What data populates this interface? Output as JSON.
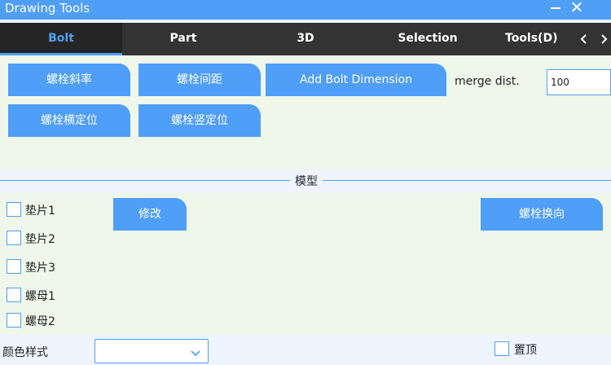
{
  "window": {
    "title": "Drawing Tools"
  },
  "tabs": [
    {
      "label": "Bolt",
      "active": true
    },
    {
      "label": "Part"
    },
    {
      "label": "3D"
    },
    {
      "label": "Selection"
    },
    {
      "label": "Tools(D)"
    }
  ],
  "bolt_panel": {
    "buttons": [
      "螺栓斜率",
      "螺栓间距",
      "Add Bolt Dimension",
      "螺栓横定位",
      "螺栓竖定位"
    ],
    "merge_label": "merge dist.",
    "merge_value": "100"
  },
  "model_section": {
    "title": "模型",
    "checkboxes": [
      "垫片1",
      "垫片2",
      "垫片3",
      "螺母1",
      "螺母2"
    ],
    "modify_label": "修改",
    "swap_label": "螺栓换向"
  },
  "footer": {
    "color_style_label": "颜色样式",
    "color_style_value": "",
    "pin_label": "置顶"
  },
  "colors": {
    "accent": "#4f9ef8",
    "tab_bg": "#333333",
    "panel_bg": "#eef7e9"
  }
}
